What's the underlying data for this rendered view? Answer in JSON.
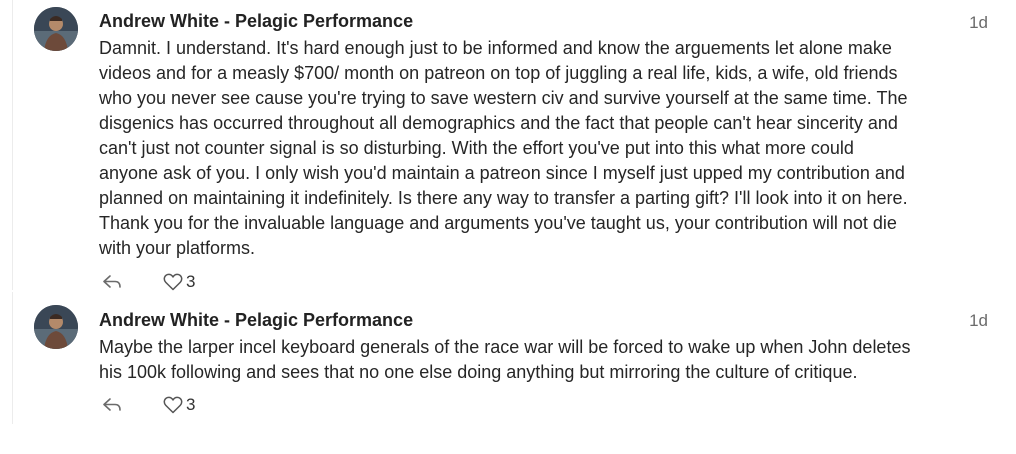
{
  "colors": {
    "author": "#222222",
    "body_text": "#262626",
    "timestamp": "#6b6b6b",
    "icon": "#6b6b6b"
  },
  "comments": [
    {
      "author": "Andrew White - Pelagic Performance",
      "time": "1d",
      "text": "Damnit. I understand. It's hard enough just to be informed and know the arguements let alone make\nvideos and for a measly $700/ month on patreon on top of juggling a real life, kids, a wife, old friends\nwho you never see cause you're trying to save western civ and survive yourself at the same time.  The\ndisgenics has occurred throughout all demographics and the fact that people can't hear sincerity and\ncan't just not counter signal is so disturbing. With the effort you've put into this what more could\nanyone ask of you. I only wish you'd maintain a patreon since I myself just upped my contribution and\nplanned on maintaining it indefinitely. Is there any way to transfer a parting gift? I'll look into it on here.\nThank you for the invaluable language and arguments you've taught us, your contribution will not die\nwith your platforms.",
      "likes": "3",
      "reply_icon": "reply-icon",
      "like_icon": "heart-icon"
    },
    {
      "author": "Andrew White - Pelagic Performance",
      "time": "1d",
      "text": "Maybe the larper incel keyboard generals of the race war will be forced to wake up when John deletes\nhis 100k following and sees that no one else doing anything but mirroring the culture of critique.",
      "likes": "3",
      "reply_icon": "reply-icon",
      "like_icon": "heart-icon"
    }
  ]
}
